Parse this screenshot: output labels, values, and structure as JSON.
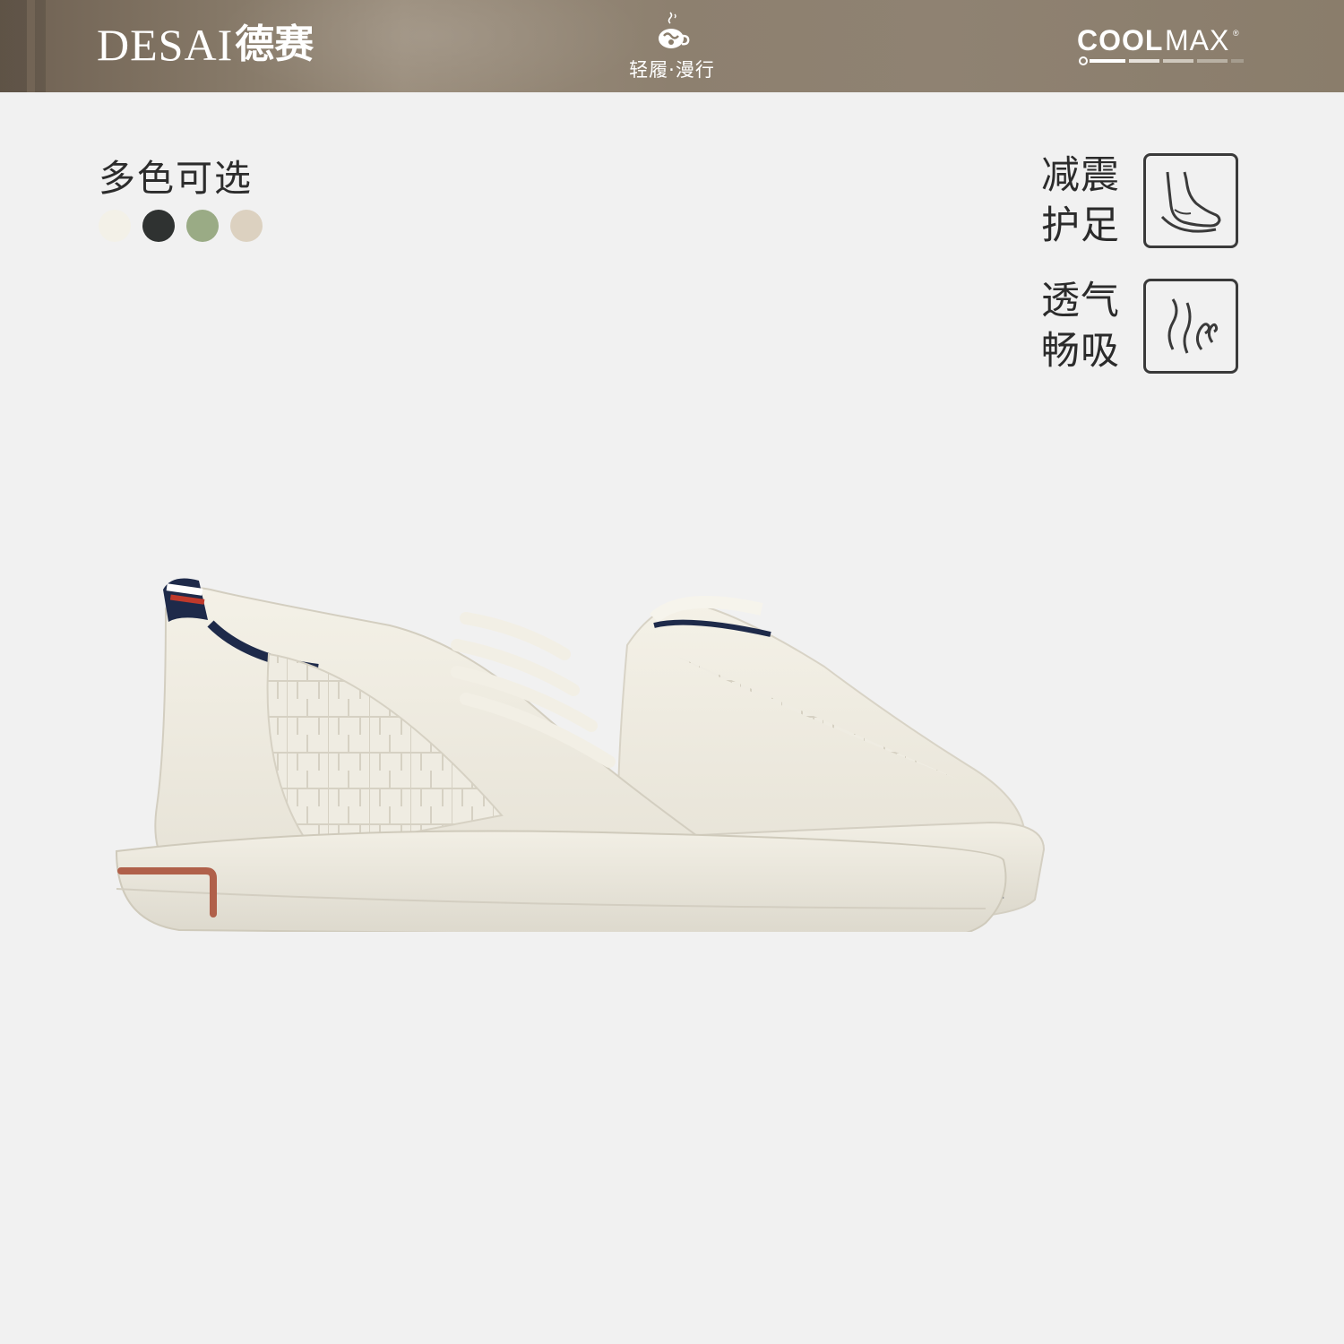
{
  "header": {
    "brand_latin": "DESAI",
    "brand_cn": "德赛",
    "slogan": "轻履·漫行",
    "partner_logo": "COOLMAX®"
  },
  "colors": {
    "title": "多色可选",
    "swatches": [
      "#f3f1e8",
      "#2f3231",
      "#9aab85",
      "#dcd1c0"
    ]
  },
  "features": [
    {
      "text_line1": "减震",
      "text_line2": "护足",
      "icon": "foot-cushion-icon"
    },
    {
      "text_line1": "透气",
      "text_line2": "畅吸",
      "icon": "breathable-icon"
    }
  ],
  "product": {
    "image": "white-sneakers-pair"
  }
}
